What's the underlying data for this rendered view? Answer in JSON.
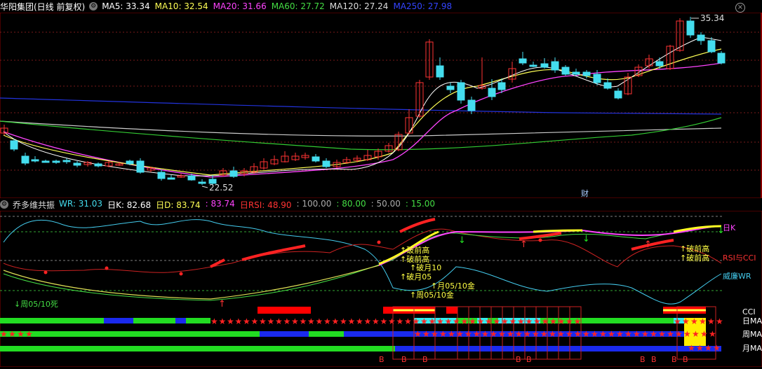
{
  "main": {
    "title": "华阳集团(日线 前复权)",
    "ma": [
      {
        "label": "MA5: 33.34",
        "color": "#ffffff"
      },
      {
        "label": "MA10: 32.54",
        "color": "#ffff55"
      },
      {
        "label": "MA20: 31.66",
        "color": "#ff44ff"
      },
      {
        "label": "MA60: 27.72",
        "color": "#44dd44"
      },
      {
        "label": "MA120: 27.24",
        "color": "#dddddd"
      },
      {
        "label": "MA250: 27.98",
        "color": "#3344ff"
      }
    ],
    "high_label": "35.34",
    "low_label": "22.52",
    "fin_marker": "财"
  },
  "indicator": {
    "title": "乔多维共振",
    "params": [
      {
        "label": "WR: 31.03",
        "color": "#44ddee"
      },
      {
        "label": "日K: 82.68",
        "color": "#ffffff"
      },
      {
        "label": "日D: 83.74",
        "color": "#ffff55"
      },
      {
        "label": ": 83.74",
        "color": "#ff44ff"
      },
      {
        "label": "日RSI: 48.90",
        "color": "#ff3333"
      },
      {
        "label": ": 100.00",
        "color": "#aaaaaa"
      },
      {
        "label": ": 80.00",
        "color": "#44dd44"
      },
      {
        "label": ": 50.00",
        "color": "#aaaaaa"
      },
      {
        "label": ": 15.00",
        "color": "#44dd44"
      }
    ],
    "annotations": {
      "dead_cross": "↓周05/10死",
      "break_high_a1": "↑破前高",
      "break_high_a2": "↑破前高",
      "break_month": "↑破月10",
      "break_month05": "↑破月05",
      "month_gold": "↑月05/10金",
      "week_gold": "↑周05/10金",
      "break_high_b1": "↑破前高",
      "break_high_b2": "↑破前高"
    },
    "right_labels": {
      "rik": "日K",
      "rsi_cci": "RSI与CCI",
      "wr": "威廉WR",
      "cci": "CCI",
      "day_ma": "日MA",
      "week_ma": "周MA",
      "month_ma": "月MA"
    },
    "b_marker": "B"
  }
}
